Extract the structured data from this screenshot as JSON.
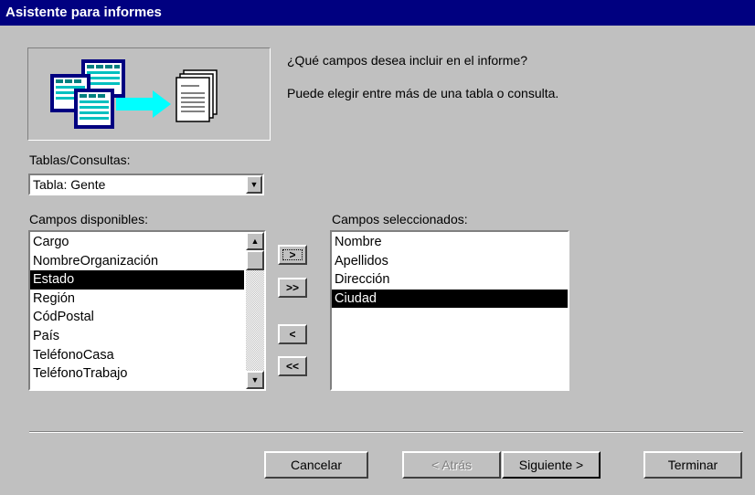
{
  "window": {
    "title": "Asistente para informes"
  },
  "prompt": {
    "line1": "¿Qué campos desea incluir en el informe?",
    "line2": "Puede elegir entre más de una tabla o consulta."
  },
  "tables": {
    "label": "Tablas/Consultas:",
    "selected": "Tabla: Gente"
  },
  "available": {
    "label": "Campos disponibles:",
    "items": [
      "Cargo",
      "NombreOrganización",
      "Estado",
      "Región",
      "CódPostal",
      "País",
      "TeléfonoCasa",
      "TeléfonoTrabajo"
    ],
    "selected_index": 2
  },
  "selected_fields": {
    "label": "Campos seleccionados:",
    "items": [
      "Nombre",
      "Apellidos",
      "Dirección",
      "Ciudad"
    ],
    "selected_index": 3
  },
  "move_buttons": {
    "add_one": ">",
    "add_all": ">>",
    "remove_one": "<",
    "remove_all": "<<"
  },
  "buttons": {
    "cancel": "Cancelar",
    "back": "< Atrás",
    "next": "Siguiente >",
    "finish": "Terminar"
  },
  "icons": {
    "picture": "report-wizard-illustration",
    "dropdown": "chevron-down-icon"
  }
}
